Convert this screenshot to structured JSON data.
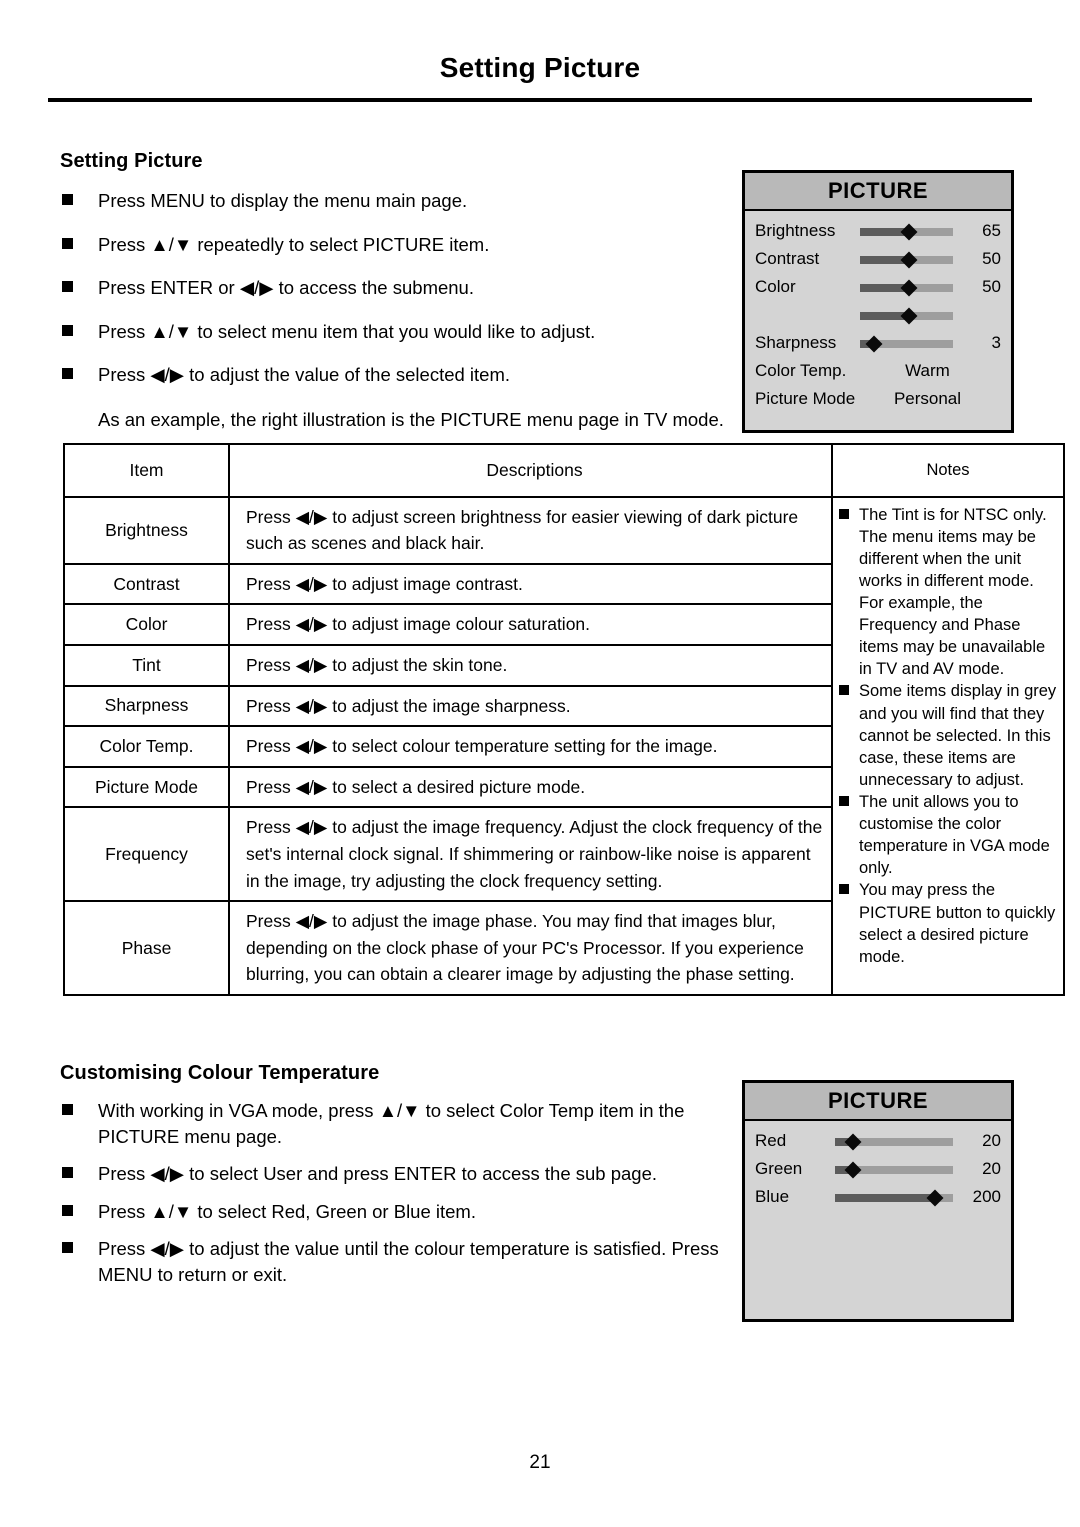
{
  "page": {
    "running_header": "Setting Picture",
    "number": "21"
  },
  "setting_picture": {
    "title": "Setting Picture",
    "bullets": [
      "Press MENU to display the menu main page.",
      "Press ▲/▼ repeatedly to select PICTURE item.",
      "Press ENTER or ◀/▶ to access the submenu.",
      "Press ▲/▼ to select menu item that you would like to adjust.",
      "Press ◀/▶ to adjust the value of the selected item."
    ],
    "note_paragraph": "As an example, the right illustration is the PICTURE menu page in TV mode."
  },
  "osd_main": {
    "title": "PICTURE",
    "rows": [
      {
        "label": "Brightness",
        "value": "65",
        "fill_pct": 53,
        "type": "slider"
      },
      {
        "label": "Contrast",
        "value": "50",
        "fill_pct": 53,
        "type": "slider"
      },
      {
        "label": "Color",
        "value": "50",
        "fill_pct": 53,
        "type": "slider"
      },
      {
        "label": "",
        "value": "",
        "fill_pct": 53,
        "type": "slider"
      },
      {
        "label": "Sharpness",
        "value": "3",
        "fill_pct": 15,
        "type": "slider"
      },
      {
        "label": "Color Temp.",
        "value": "Warm",
        "type": "text"
      },
      {
        "label": "Picture Mode",
        "value": "Personal",
        "type": "text"
      }
    ]
  },
  "osd_rgb": {
    "title": "PICTURE",
    "rows": [
      {
        "label": "Red",
        "value": "20",
        "fill_pct": 15,
        "type": "slider"
      },
      {
        "label": "Green",
        "value": "20",
        "fill_pct": 15,
        "type": "slider"
      },
      {
        "label": "Blue",
        "value": "200",
        "fill_pct": 85,
        "type": "slider"
      }
    ]
  },
  "table": {
    "headers": {
      "item": "Item",
      "descriptions": "Descriptions",
      "notes": "Notes"
    },
    "rows": [
      {
        "item": "Brightness",
        "description": "Press ◀/▶ to adjust screen brightness for easier viewing of dark picture such as scenes and black hair."
      },
      {
        "item": "Contrast",
        "description": "Press ◀/▶ to adjust image contrast."
      },
      {
        "item": "Color",
        "description": "Press ◀/▶ to adjust image colour saturation."
      },
      {
        "item": "Tint",
        "description": "Press ◀/▶ to adjust the skin tone."
      },
      {
        "item": "Sharpness",
        "description": "Press ◀/▶ to adjust the image sharpness."
      },
      {
        "item": "Color Temp.",
        "description": "Press ◀/▶ to select colour temperature setting for the image."
      },
      {
        "item": "Picture Mode",
        "description": "Press ◀/▶ to select a desired picture mode."
      },
      {
        "item": "Frequency",
        "description": "Press ◀/▶ to adjust the image frequency. Adjust the clock frequency of the set's internal clock signal. If shimmering or rainbow-like noise is apparent in the image, try adjusting the clock frequency setting."
      },
      {
        "item": "Phase",
        "description": "Press ◀/▶ to adjust the image phase. You may find that images blur, depending on the clock phase of your PC's Processor. If you experience blurring, you can obtain a clearer image by adjusting the phase setting."
      }
    ],
    "notes": [
      {
        "bullet": "The Tint is for NTSC only.",
        "continuation": "The menu items may be different when the unit works in different mode. For example, the Frequency and Phase items may be unavailable in TV and AV mode."
      },
      {
        "bullet": "Some items display in grey and you will find that they cannot be selected. In this case, these items are unnecessary to adjust.",
        "continuation": ""
      },
      {
        "bullet": "The unit allows you to customise the color temperature in VGA mode only.",
        "continuation": ""
      },
      {
        "bullet": "You may press the PICTURE button to quickly select a desired picture mode.",
        "continuation": ""
      }
    ]
  },
  "customising": {
    "title": "Customising Colour Temperature",
    "bullets": [
      "With working in VGA mode, press ▲/▼ to select Color Temp item in the PICTURE menu page.",
      "Press ◀/▶ to select User and press ENTER to access the sub page.",
      "Press ▲/▼ to select Red, Green or Blue item.",
      "Press ◀/▶ to adjust the value until the colour temperature is satisfied. Press MENU to return or exit."
    ]
  }
}
